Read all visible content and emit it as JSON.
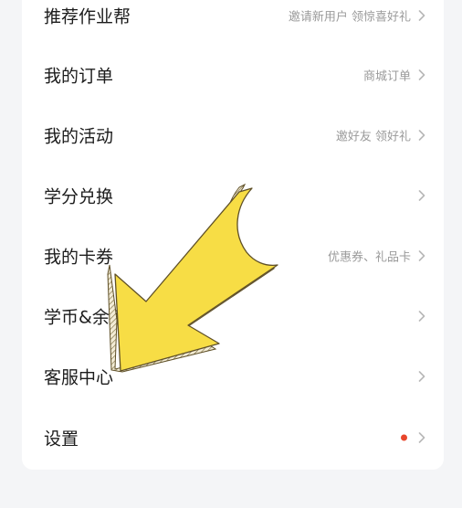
{
  "menu": {
    "items": [
      {
        "label": "推荐作业帮",
        "hint": "邀请新用户 领惊喜好礼"
      },
      {
        "label": "我的订单",
        "hint": "商城订单"
      },
      {
        "label": "我的活动",
        "hint": "邀好友 领好礼"
      },
      {
        "label": "学分兑换",
        "hint": ""
      },
      {
        "label": "我的卡券",
        "hint": "优惠券、礼品卡"
      },
      {
        "label": "学币&余额",
        "hint": ""
      },
      {
        "label": "客服中心",
        "hint": ""
      },
      {
        "label": "设置",
        "hint": ""
      }
    ]
  },
  "icons": {
    "chevron": "chevron-right-icon",
    "overlay": "pointing-arrow-icon"
  },
  "colors": {
    "background": "#f4f5f7",
    "card": "#ffffff",
    "label": "#1c1c1c",
    "hint": "#9a9a9a",
    "chevron": "#b8b8b8",
    "notification_dot": "#e8462c",
    "arrow_fill": "#f7dd45",
    "arrow_outline": "#6b5a2a"
  }
}
